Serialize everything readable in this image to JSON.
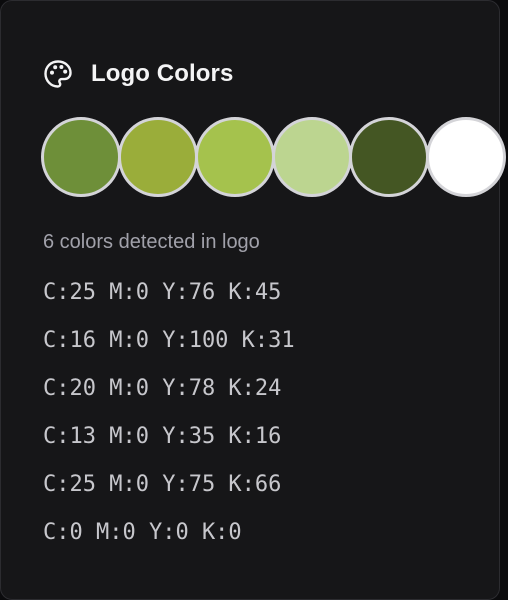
{
  "card": {
    "title": "Logo Colors",
    "icon": "palette-icon",
    "swatches": [
      {
        "color": "#6e8f39"
      },
      {
        "color": "#9aad3a"
      },
      {
        "color": "#a5c24d"
      },
      {
        "color": "#bcd590"
      },
      {
        "color": "#445623"
      },
      {
        "color": "#ffffff"
      }
    ],
    "detected_text": "6 colors detected in logo",
    "cmyk_values": [
      "C:25 M:0 Y:76 K:45",
      "C:16 M:0 Y:100 K:31",
      "C:20 M:0 Y:78 K:24",
      "C:13 M:0 Y:35 K:16",
      "C:25 M:0 Y:75 K:66",
      "C:0 M:0 Y:0 K:0"
    ]
  }
}
